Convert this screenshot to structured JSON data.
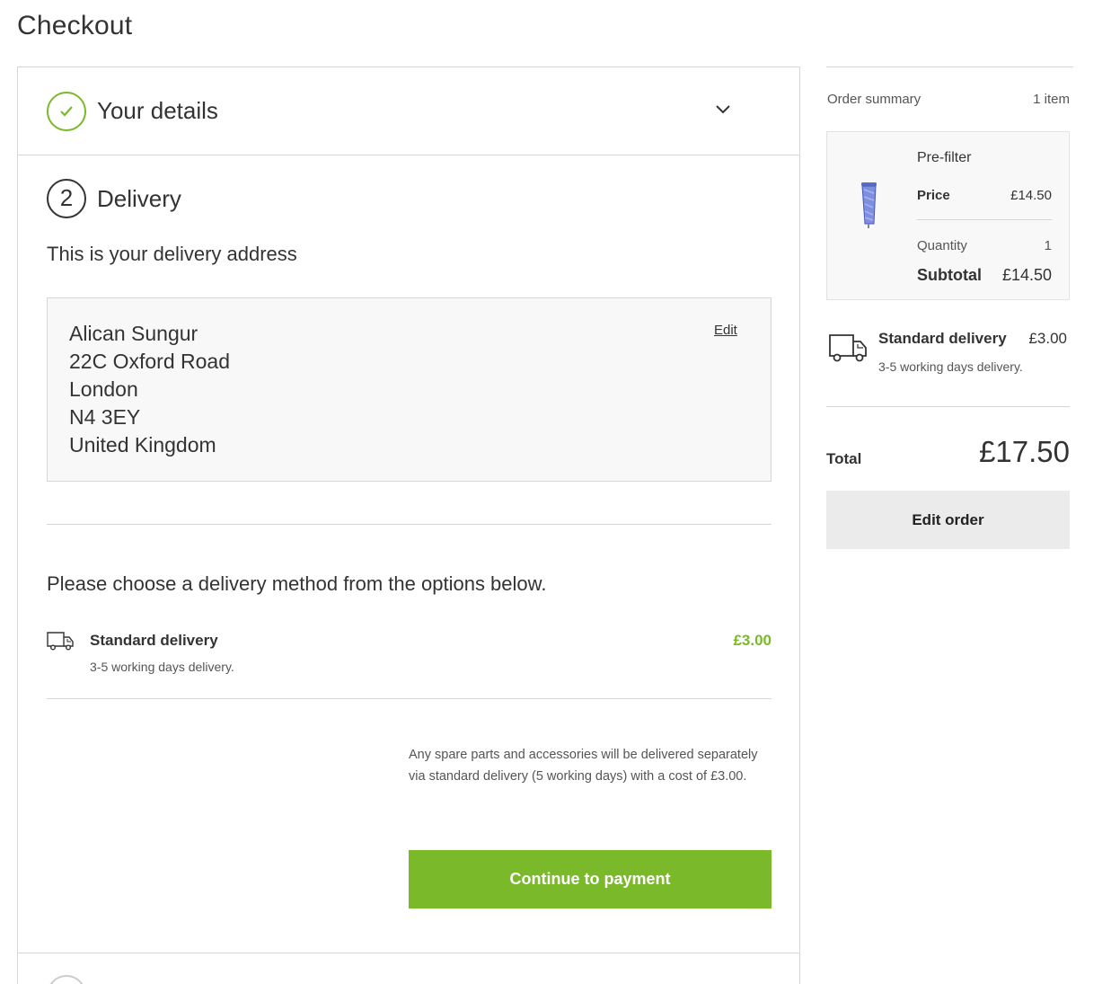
{
  "page": {
    "title": "Checkout"
  },
  "steps": {
    "details": {
      "title": "Your details",
      "status_icon": "check-icon",
      "toggle_icon": "chevron-down-icon"
    },
    "delivery": {
      "number": "2",
      "title": "Delivery",
      "address_intro": "This is your delivery address",
      "address": {
        "lines": [
          "Alican Sungur",
          "22C Oxford Road",
          "London",
          "N4 3EY",
          "United Kingdom"
        ],
        "edit_label": "Edit"
      },
      "method_intro": "Please choose a delivery method from the options below.",
      "method": {
        "icon": "truck-icon",
        "name": "Standard delivery",
        "description": "3-5 working days delivery.",
        "price": "£3.00"
      },
      "note": "Any spare parts and accessories will be delivered separately via standard delivery (5 working days) with a cost of £3.00.",
      "continue_label": "Continue to payment"
    }
  },
  "summary": {
    "label": "Order summary",
    "count": "1 item",
    "item": {
      "name": "Pre-filter",
      "price_label": "Price",
      "price": "£14.50",
      "quantity_label": "Quantity",
      "quantity": "1",
      "subtotal_label": "Subtotal",
      "subtotal": "£14.50"
    },
    "delivery": {
      "icon": "truck-icon",
      "name": "Standard delivery",
      "price": "£3.00",
      "description": "3-5 working days delivery."
    },
    "total_label": "Total",
    "total": "£17.50",
    "edit_order_label": "Edit order"
  },
  "colors": {
    "accent": "#7ab929",
    "border": "#d6d6d6",
    "panel_bg": "#f8f8f8",
    "secondary_button": "#ebebeb"
  }
}
